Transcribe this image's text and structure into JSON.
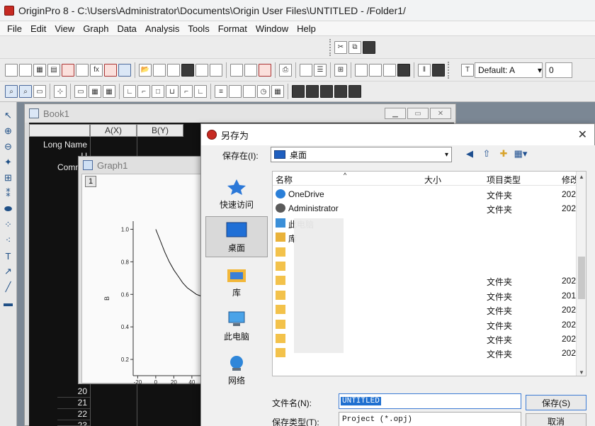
{
  "app": {
    "title": "OriginPro 8 - C:\\Users\\Administrator\\Documents\\Origin User Files\\UNTITLED - /Folder1/"
  },
  "menus": [
    "File",
    "Edit",
    "View",
    "Graph",
    "Data",
    "Analysis",
    "Tools",
    "Format",
    "Window",
    "Help"
  ],
  "format_toolbar": {
    "font": "Default: A",
    "size": "0"
  },
  "book1": {
    "title": "Book1",
    "columns": [
      "A(X)",
      "B(Y)"
    ],
    "row_labels": [
      "Long Name",
      "U",
      "Comme"
    ],
    "row_numbers": [
      "20",
      "21",
      "22",
      "23"
    ]
  },
  "graph1": {
    "title": "Graph1",
    "layer": "1",
    "ylabel": "B",
    "yticks": [
      "1.0",
      "0.8",
      "0.6",
      "0.4",
      "0.2"
    ],
    "xticks": [
      "-20",
      "0",
      "20",
      "40"
    ]
  },
  "chart_data": {
    "type": "line",
    "x": [
      0,
      5,
      10,
      15,
      20,
      25,
      30,
      35,
      40,
      45,
      50
    ],
    "y": [
      1.0,
      0.93,
      0.86,
      0.8,
      0.75,
      0.71,
      0.67,
      0.64,
      0.62,
      0.6,
      0.59
    ],
    "title": "",
    "xlabel": "",
    "ylabel": "B",
    "xlim": [
      -25,
      55
    ],
    "ylim": [
      0.1,
      1.05
    ],
    "grid": false
  },
  "dialog": {
    "title": "另存为",
    "look_in_label": "保存在(I):",
    "look_in_value": "桌面",
    "places": [
      "快速访问",
      "桌面",
      "库",
      "此电脑",
      "网络"
    ],
    "columns": [
      "名称",
      "大小",
      "项目类型",
      "修改"
    ],
    "files": [
      {
        "name": "OneDrive",
        "type": "文件夹",
        "date": "202",
        "icon": "cloud"
      },
      {
        "name": "Administrator",
        "type": "文件夹",
        "date": "202",
        "icon": "user"
      },
      {
        "name": "此电脑",
        "type": "",
        "date": "",
        "icon": "computer"
      },
      {
        "name": "库",
        "type": "",
        "date": "",
        "icon": "library"
      },
      {
        "name": "",
        "type": "",
        "date": "",
        "icon": "folder"
      },
      {
        "name": "",
        "type": "",
        "date": "",
        "icon": "folder"
      },
      {
        "name": "",
        "type": "文件夹",
        "date": "202",
        "icon": "folder"
      },
      {
        "name": "",
        "type": "文件夹",
        "date": "201",
        "icon": "folder"
      },
      {
        "name": "",
        "type": "文件夹",
        "date": "202",
        "icon": "folder"
      },
      {
        "name": "",
        "type": "文件夹",
        "date": "202",
        "icon": "folder"
      },
      {
        "name": "",
        "type": "文件夹",
        "date": "202",
        "icon": "folder"
      },
      {
        "name": "",
        "type": "文件夹",
        "date": "202",
        "icon": "folder"
      }
    ],
    "filename_label": "文件名(N):",
    "filename_value": "UNTITLED",
    "filetype_label": "保存类型(T):",
    "filetype_value": "Project (*.opj)",
    "save_label": "保存(S)",
    "cancel_label": "取消"
  }
}
